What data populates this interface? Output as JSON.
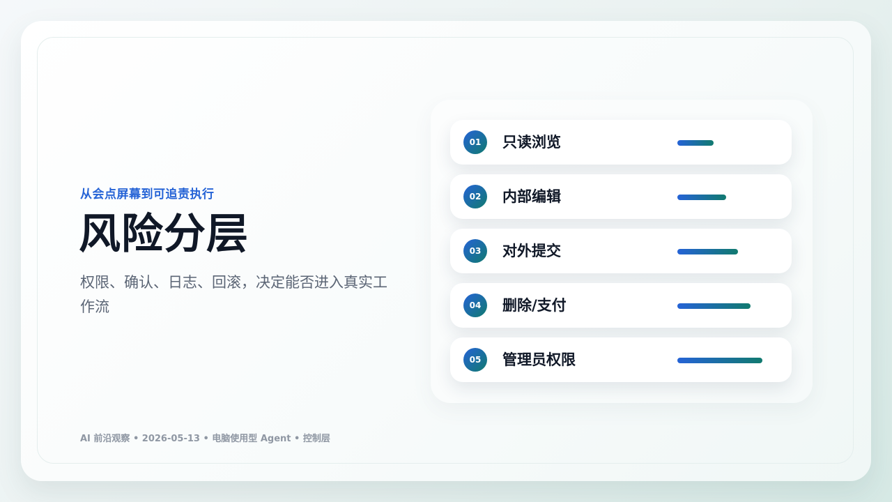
{
  "kicker": "从会点屏幕到可追责执行",
  "title": "风险分层",
  "subtitle": "权限、确认、日志、回滚，决定能否进入真实工作流",
  "footer": "AI 前沿观察 • 2026-05-13 • 电脑使用型 Agent • 控制层",
  "colors": {
    "accent_blue": "#2563d6",
    "accent_teal": "#117a6f",
    "title": "#101827",
    "muted": "#5b6575"
  },
  "levels": [
    {
      "num": "01",
      "label": "只读浏览",
      "risk": 0.2
    },
    {
      "num": "02",
      "label": "内部编辑",
      "risk": 0.4
    },
    {
      "num": "03",
      "label": "对外提交",
      "risk": 0.6
    },
    {
      "num": "04",
      "label": "删除/支付",
      "risk": 0.8
    },
    {
      "num": "05",
      "label": "管理员权限",
      "risk": 1.0
    }
  ]
}
